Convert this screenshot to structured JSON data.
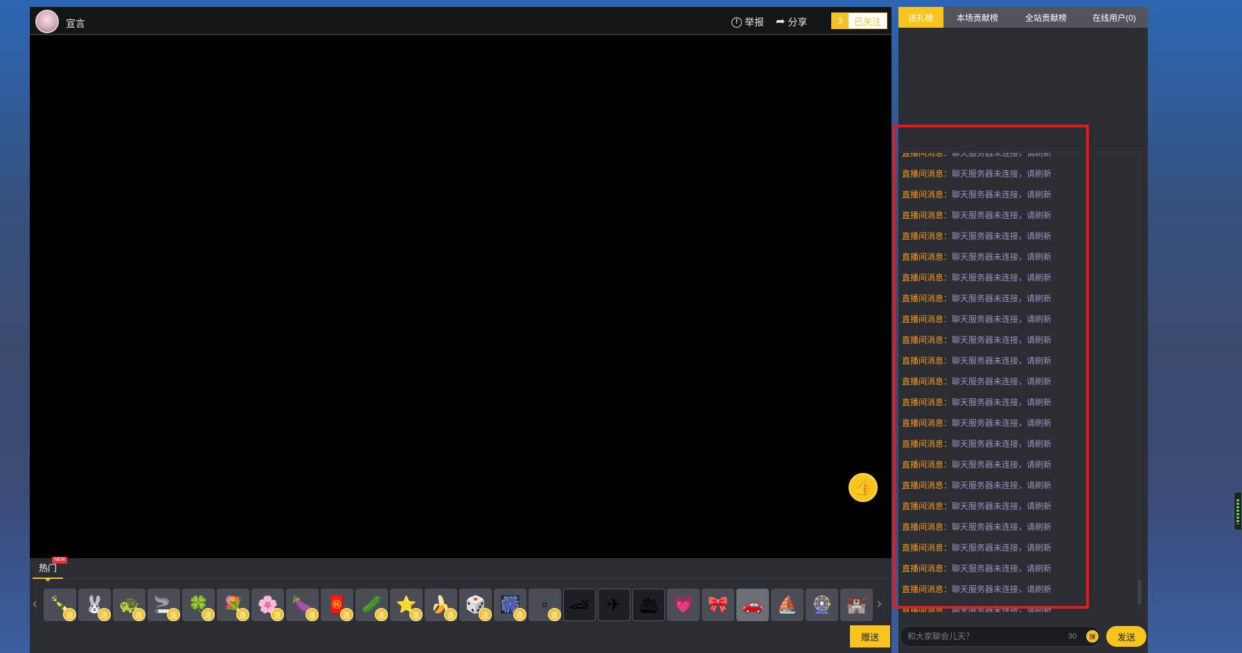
{
  "header": {
    "host_name": "宣言",
    "report_label": "举报",
    "share_label": "分享",
    "follow_count": "3",
    "follow_label": "已关注"
  },
  "gift_tabs": {
    "hot_label": "热门",
    "new_badge": "NEW"
  },
  "gifts": [
    {
      "icon": "champagne-bottle-icon",
      "glyph": "🍾",
      "lian": true
    },
    {
      "icon": "cartoon-character-icon",
      "glyph": "🐰",
      "lian": true
    },
    {
      "icon": "turtle-icon",
      "glyph": "🐢",
      "lian": true
    },
    {
      "icon": "cigar-icon",
      "glyph": "🚬",
      "lian": true
    },
    {
      "icon": "four-leaf-clover-icon",
      "glyph": "🍀",
      "lian": true
    },
    {
      "icon": "flower-bunch-icon",
      "glyph": "💐",
      "lian": true
    },
    {
      "icon": "lily-flower-icon",
      "glyph": "🌸",
      "lian": true
    },
    {
      "icon": "eggplant-icon",
      "glyph": "🍆",
      "lian": true
    },
    {
      "icon": "red-gift-box-icon",
      "glyph": "🧧",
      "lian": true
    },
    {
      "icon": "cucumber-icon",
      "glyph": "🥒",
      "lian": true
    },
    {
      "icon": "star-trophy-icon",
      "glyph": "⭐",
      "lian": true
    },
    {
      "icon": "banana-icon",
      "glyph": "🍌",
      "lian": true
    },
    {
      "icon": "red-dice-icon",
      "glyph": "🎲",
      "lian": true
    },
    {
      "icon": "colorful-balloon-icon",
      "glyph": "🎆",
      "lian": true
    },
    {
      "icon": "broken-image-icon",
      "glyph": "▫",
      "lian": true
    },
    {
      "icon": "race-car-icon",
      "glyph": "🏎",
      "lian": false
    },
    {
      "icon": "fighter-jet-icon",
      "glyph": "✈",
      "lian": false
    },
    {
      "icon": "cruise-ship-icon",
      "glyph": "🛳",
      "lian": false
    },
    {
      "icon": "heart-outline-icon",
      "glyph": "💗",
      "lian": false
    },
    {
      "icon": "pink-ribbon-icon",
      "glyph": "🎀",
      "lian": false
    },
    {
      "icon": "silver-car-icon",
      "glyph": "🚗",
      "lian": false
    },
    {
      "icon": "yacht-icon",
      "glyph": "⛵",
      "lian": false
    },
    {
      "icon": "carriage-icon",
      "glyph": "🎡",
      "lian": false
    },
    {
      "icon": "castle-moon-icon",
      "glyph": "🏰",
      "lian": false
    }
  ],
  "gift_lian_label": "连",
  "send_gift_label": "赠送",
  "rank_tabs": [
    {
      "label": "送礼榜",
      "active": true
    },
    {
      "label": "本场贡献榜",
      "active": false
    },
    {
      "label": "全站贡献榜",
      "active": false
    },
    {
      "label": "在线用户(0)",
      "active": false
    }
  ],
  "chat": {
    "messages": [
      {
        "label": "直播间消息：",
        "text": "聊天服务器未连接，请刷新"
      },
      {
        "label": "直播间消息：",
        "text": "聊天服务器未连接，请刷新"
      },
      {
        "label": "直播间消息：",
        "text": "聊天服务器未连接，请刷新"
      },
      {
        "label": "直播间消息：",
        "text": "聊天服务器未连接，请刷新"
      },
      {
        "label": "直播间消息：",
        "text": "聊天服务器未连接，请刷新"
      },
      {
        "label": "直播间消息：",
        "text": "聊天服务器未连接，请刷新"
      },
      {
        "label": "直播间消息：",
        "text": "聊天服务器未连接，请刷新"
      },
      {
        "label": "直播间消息：",
        "text": "聊天服务器未连接，请刷新"
      },
      {
        "label": "直播间消息：",
        "text": "聊天服务器未连接，请刷新"
      },
      {
        "label": "直播间消息：",
        "text": "聊天服务器未连接，请刷新"
      },
      {
        "label": "直播间消息：",
        "text": "聊天服务器未连接，请刷新"
      },
      {
        "label": "直播间消息：",
        "text": "聊天服务器未连接，请刷新"
      },
      {
        "label": "直播间消息：",
        "text": "聊天服务器未连接，请刷新"
      },
      {
        "label": "直播间消息：",
        "text": "聊天服务器未连接，请刷新"
      },
      {
        "label": "直播间消息：",
        "text": "聊天服务器未连接，请刷新"
      },
      {
        "label": "直播间消息：",
        "text": "聊天服务器未连接，请刷新"
      },
      {
        "label": "直播间消息：",
        "text": "聊天服务器未连接，请刷新"
      },
      {
        "label": "直播间消息：",
        "text": "聊天服务器未连接，请刷新"
      },
      {
        "label": "直播间消息：",
        "text": "聊天服务器未连接，请刷新"
      },
      {
        "label": "直播间消息：",
        "text": "聊天服务器未连接，请刷新"
      },
      {
        "label": "直播间消息：",
        "text": "聊天服务器未连接，请刷新"
      },
      {
        "label": "直播间消息：",
        "text": "聊天服务器未连接，请刷新"
      },
      {
        "label": "直播间消息：",
        "text": "聊天服务器未连接，请刷新"
      }
    ],
    "input_placeholder": "和大家聊会儿天？",
    "char_limit": "30",
    "danmu_label": "弹",
    "send_label": "发送"
  },
  "colors": {
    "accent": "#f8c51f",
    "highlight_frame": "#e31b1b",
    "chat_label": "#f39a23",
    "chat_text": "#9e8fc0"
  }
}
